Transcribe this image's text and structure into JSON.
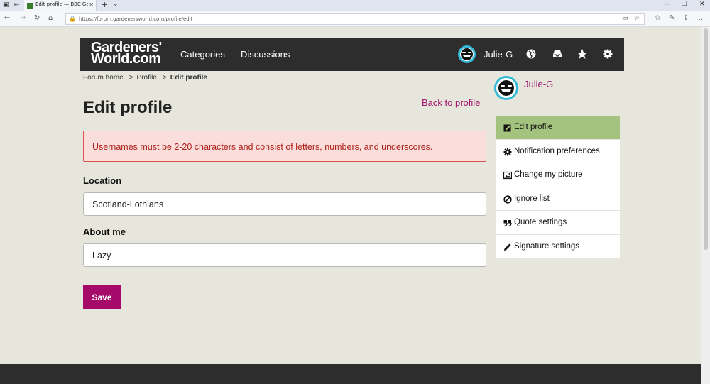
{
  "browser": {
    "tab_title": "Edit profile — BBC Gard",
    "url": "https://forum.gardenersworld.com/profile/edit"
  },
  "header": {
    "logo_line1": "Gardeners'",
    "logo_line2": "World.com",
    "nav": [
      "Categories",
      "Discussions"
    ],
    "username": "Julie-G"
  },
  "breadcrumb": [
    "Forum home",
    "Profile",
    "Edit profile"
  ],
  "main": {
    "title": "Edit profile",
    "back_link": "Back to profile",
    "error": "Usernames must be 2-20 characters and consist of letters, numbers, and underscores.",
    "location_label": "Location",
    "location_value": "Scotland-Lothians",
    "about_label": "About me",
    "about_value": "Lazy",
    "save_label": "Save"
  },
  "sidebar": {
    "username": "Julie-G",
    "items": [
      {
        "label": "Edit profile",
        "icon": "edit-icon",
        "active": true
      },
      {
        "label": "Notification preferences",
        "icon": "gear-icon"
      },
      {
        "label": "Change my picture",
        "icon": "image-icon"
      },
      {
        "label": "Ignore list",
        "icon": "ban-icon"
      },
      {
        "label": "Quote settings",
        "icon": "quote-icon"
      },
      {
        "label": "Signature settings",
        "icon": "pencil-icon"
      }
    ]
  },
  "colors": {
    "accent": "#a50a6b",
    "header_bg": "#2d2d2d",
    "active_menu": "#a3c37f",
    "page_bg": "#e6e6dc"
  }
}
